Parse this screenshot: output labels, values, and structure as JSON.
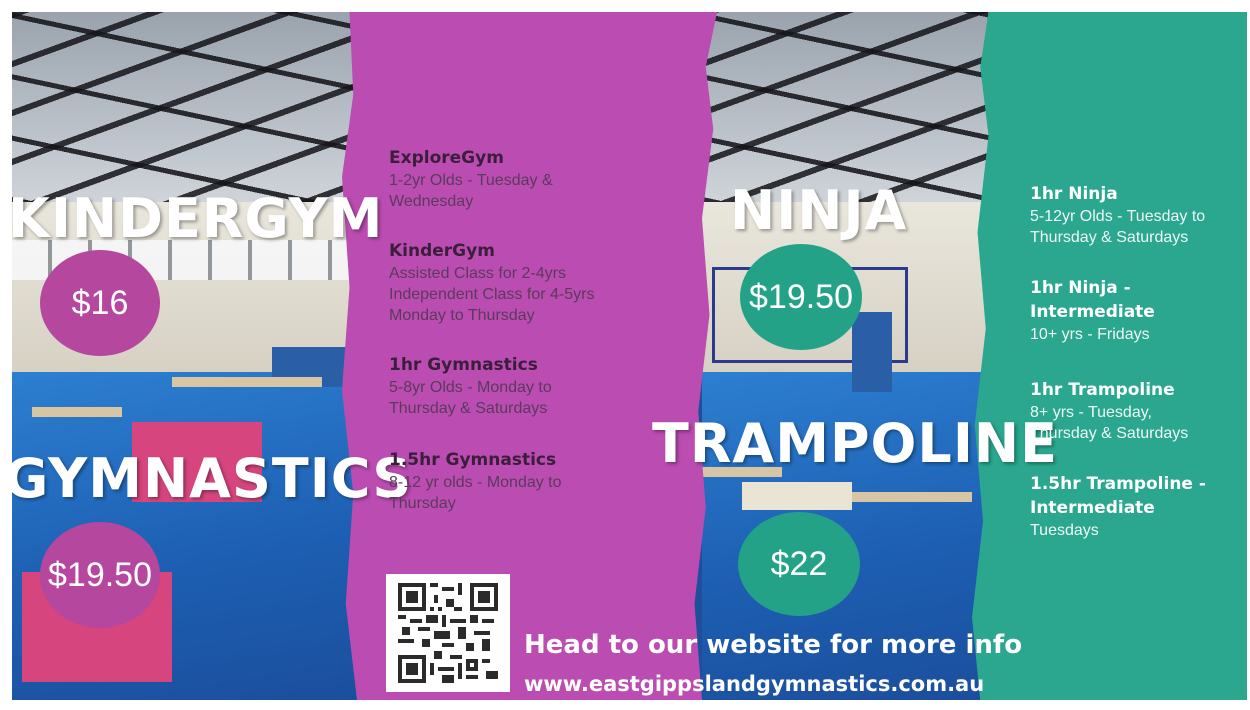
{
  "headings": {
    "kindergym": "KINDERGYM",
    "gymnastics": "GYMNASTICS",
    "ninja": "NINJA",
    "trampoline": "TRAMPOLINE"
  },
  "prices": {
    "kindergym": "$16",
    "gymnastics": "$19.50",
    "ninja": "$19.50",
    "trampoline": "$22"
  },
  "purple_classes": [
    {
      "title": "ExploreGym",
      "detail": "1-2yr Olds - Tuesday &\nWednesday"
    },
    {
      "title": "KinderGym",
      "detail": "Assisted Class for 2-4yrs\nIndependent Class for 4-5yrs\nMonday to Thursday"
    },
    {
      "title": "1hr Gymnastics",
      "detail": "5-8yr Olds - Monday to\nThursday & Saturdays"
    },
    {
      "title": "1.5hr Gymnastics",
      "detail": "8-12 yr olds - Monday to\nThursday"
    }
  ],
  "teal_classes": [
    {
      "title": "1hr Ninja",
      "detail": "5-12yr Olds - Tuesday to\nThursday & Saturdays"
    },
    {
      "title": "1hr Ninja -\nIntermediate",
      "detail": "10+ yrs - Fridays"
    },
    {
      "title": "1hr Trampoline",
      "detail": "8+ yrs - Tuesday,\nThursday & Saturdays"
    },
    {
      "title": "1.5hr Trampoline -\nIntermediate",
      "detail": "Tuesdays"
    }
  ],
  "cta": {
    "text": "Head to our website for more info",
    "url": "www.eastgippslandgymnastics.com.au"
  },
  "colors": {
    "purple": "#bb4cb2",
    "teal": "#2aa78e",
    "price_purple": "#b5479e",
    "price_teal": "#24a287"
  }
}
